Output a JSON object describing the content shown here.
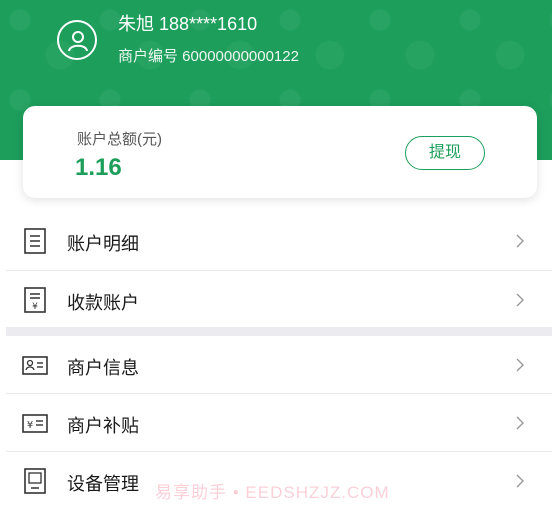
{
  "header": {
    "user_name": "朱旭 188****1610",
    "merchant_no": "商户编号 60000000000122",
    "bg_color": "#1d9e5b"
  },
  "balance": {
    "label": "账户总额(元)",
    "value": "1.16",
    "withdraw_label": "提现"
  },
  "menu": [
    {
      "label": "账户明细",
      "icon": "document-list-icon"
    },
    {
      "label": "收款账户",
      "icon": "yuan-document-icon"
    },
    {
      "label": "商户信息",
      "icon": "id-card-icon"
    },
    {
      "label": "商户补贴",
      "icon": "yuan-card-icon"
    },
    {
      "label": "设备管理",
      "icon": "device-icon"
    }
  ],
  "watermark": "易享助手 • EEDSHZJZ.COM",
  "accent_color": "#1d9e5b"
}
